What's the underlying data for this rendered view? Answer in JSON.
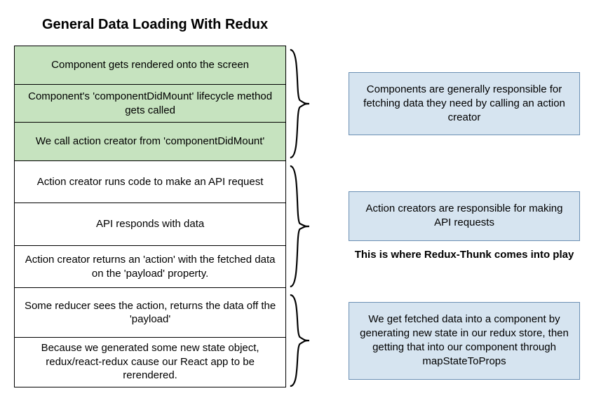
{
  "title": "General Data Loading With Redux",
  "groups": [
    {
      "color": "green",
      "steps": [
        "Component gets rendered onto the screen",
        "Component's 'componentDidMount' lifecycle method gets called",
        "We call action creator from 'componentDidMount'"
      ],
      "note": "Components are generally responsible for fetching data they need by calling an action creator",
      "extra": null
    },
    {
      "color": "white",
      "steps": [
        "Action creator runs code to make an API request",
        "API responds with data",
        "Action creator returns an 'action' with the fetched data on the 'payload' property."
      ],
      "note": "Action creators are responsible for making API requests",
      "extra": "This is where Redux-Thunk comes into play"
    },
    {
      "color": "white",
      "steps": [
        "Some reducer sees the action, returns the data off the 'payload'",
        "Because we generated some new state object, redux/react-redux cause our React app to be rerendered."
      ],
      "note": "We get fetched data into a component by generating new state in our redux store, then getting that into our component through mapStateToProps",
      "extra": null
    }
  ]
}
